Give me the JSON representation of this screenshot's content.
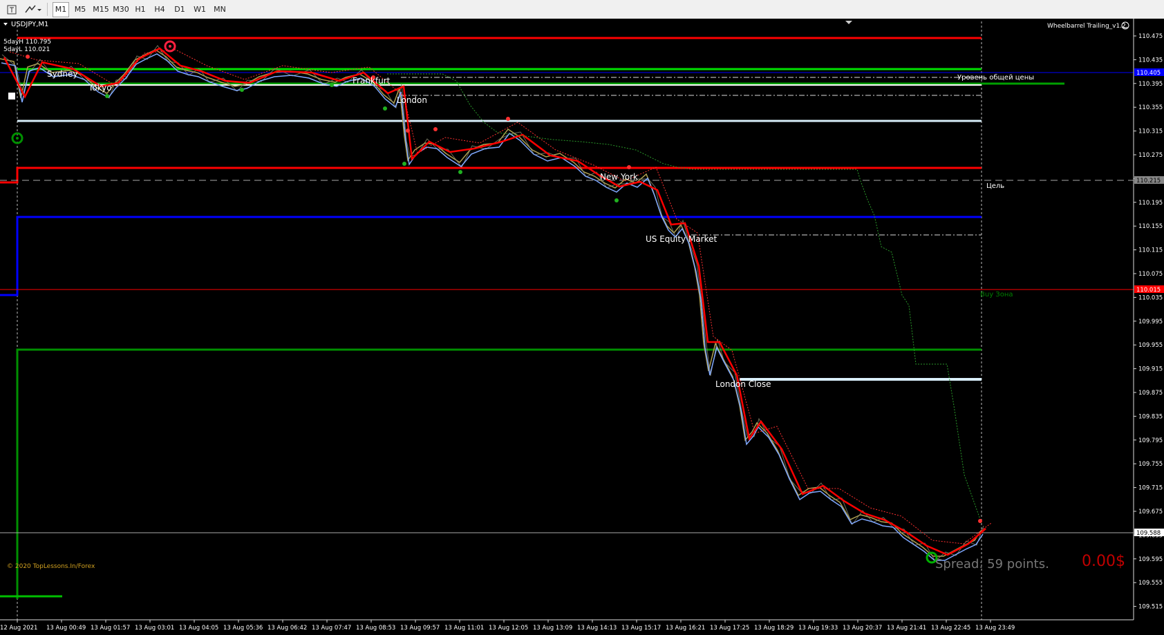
{
  "toolbar": {
    "timeframes": [
      "M1",
      "M5",
      "M15",
      "M30",
      "H1",
      "H4",
      "D1",
      "W1",
      "MN"
    ],
    "selected": "M1"
  },
  "chart": {
    "symbol_label": "USDJPY,M1",
    "five_day_high": "5dayH 110.795",
    "five_day_low": "5dayL 110.021",
    "indicator_name": "Wheelbarrel Trailing_v1.2",
    "copyright": "© 2020 TopLessons.In/Forex",
    "spread_text": "Spread: 59 points.",
    "profit_text": "0.00$",
    "sessions": [
      "Sydney",
      "Tokyo",
      "Frankfurt",
      "London",
      "New York",
      "US Equity Market",
      "London Close"
    ],
    "level_labels": {
      "common_price": "Уровень общей цены",
      "target": "Цель",
      "buy_zone": "Buy Зона"
    },
    "price_axis": [
      "110.475",
      "110.435",
      "110.395",
      "110.355",
      "110.315",
      "110.275",
      "110.235",
      "110.195",
      "110.155",
      "110.115",
      "110.075",
      "110.035",
      "109.995",
      "109.955",
      "109.915",
      "109.875",
      "109.835",
      "109.795",
      "109.755",
      "109.715",
      "109.675",
      "109.635",
      "109.595",
      "109.555",
      "109.515"
    ],
    "price_tags": {
      "blue": "110.405",
      "target": "110.215",
      "red": "110.015",
      "current": "109.588"
    },
    "time_axis": [
      "12 Aug 2021",
      "13 Aug 00:49",
      "13 Aug 01:57",
      "13 Aug 03:01",
      "13 Aug 04:05",
      "13 Aug 05:36",
      "13 Aug 06:42",
      "13 Aug 07:47",
      "13 Aug 08:53",
      "13 Aug 09:57",
      "13 Aug 11:01",
      "13 Aug 12:05",
      "13 Aug 13:09",
      "13 Aug 14:13",
      "13 Aug 15:17",
      "13 Aug 16:21",
      "13 Aug 17:25",
      "13 Aug 18:29",
      "13 Aug 19:33",
      "13 Aug 20:37",
      "13 Aug 21:41",
      "13 Aug 22:45",
      "13 Aug 23:49"
    ],
    "colors": {
      "bg": "#000000",
      "red": "#ff0000",
      "green": "#00c000",
      "blue": "#0000ff",
      "lightblue": "#c8e8f8",
      "price": "#b0a050",
      "ma_blue": "#7fa8ff"
    }
  }
}
